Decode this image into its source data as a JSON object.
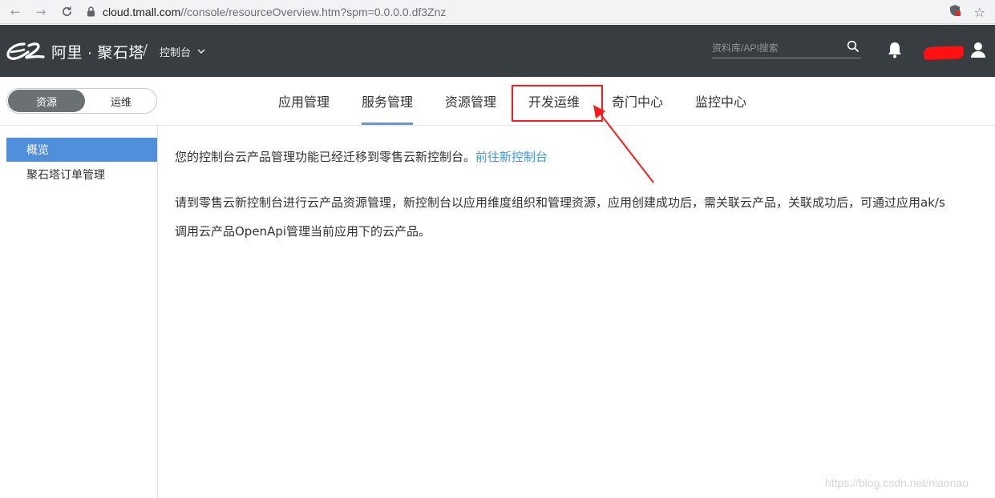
{
  "browser": {
    "url_host": "cloud.tmall.com",
    "url_path": "//console/resourceOverview.htm?spm=0.0.0.0.df3Znz"
  },
  "header": {
    "brand": "阿里 · 聚石塔",
    "console_label": "控制台",
    "search_placeholder": "资料库/API搜索",
    "bg_color": "#373d41"
  },
  "mode_toggle": {
    "active": "资源",
    "inactive": "运维"
  },
  "tabs": [
    {
      "label": "应用管理",
      "active": false
    },
    {
      "label": "服务管理",
      "active": true
    },
    {
      "label": "资源管理",
      "active": false
    },
    {
      "label": "开发运维",
      "active": false,
      "highlighted": true
    },
    {
      "label": "奇门中心",
      "active": false
    },
    {
      "label": "监控中心",
      "active": false
    }
  ],
  "sidebar": {
    "items": [
      {
        "label": "概览",
        "active": true
      },
      {
        "label": "聚石塔订单管理",
        "active": false
      }
    ]
  },
  "main": {
    "notice_text": "您的控制台云产品管理功能已经迁移到零售云新控制台。",
    "notice_link": "前往新控制台",
    "para1": "请到零售云新控制台进行云产品资源管理，新控制台以应用维度组织和管理资源，应用创建成功后，需关联云产品，关联成功后，可通过应用ak/s",
    "para2": "调用云产品OpenApi管理当前应用下的云产品。"
  },
  "watermark": "https://blog.csdn.net/niaonao",
  "colors": {
    "accent": "#4f8fdb",
    "link": "#3b97e6",
    "annotation": "#ff1a1a"
  }
}
